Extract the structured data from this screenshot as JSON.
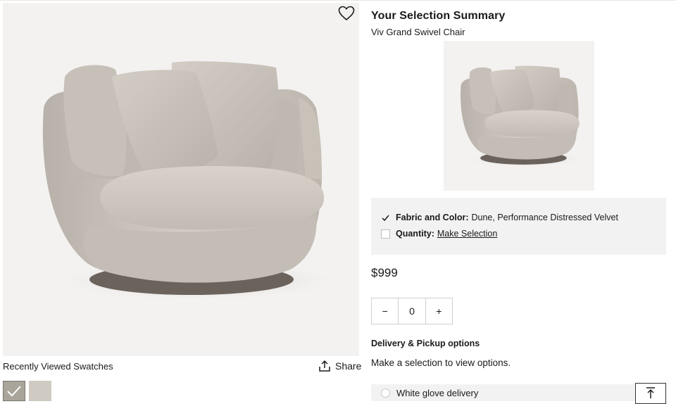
{
  "product": {
    "image_alt": "Viv Grand Swivel Chair",
    "colors": {
      "fabric": "#cbc5bd",
      "fabric_shadow": "#a39c94",
      "base": "#6b625c",
      "background": "#f3f2f1"
    }
  },
  "favorite": {
    "icon": "heart-outline-icon"
  },
  "recently_viewed": {
    "label": "Recently Viewed Swatches",
    "swatches": [
      {
        "color": "#a9a59b",
        "selected": true
      },
      {
        "color": "#cfcbc2",
        "selected": false
      }
    ]
  },
  "share": {
    "label": "Share",
    "icon": "share-upload-icon"
  },
  "summary": {
    "title": "Your Selection Summary",
    "product_name": "Viv Grand Swivel Chair",
    "fabric_label": "Fabric and Color:",
    "fabric_value": "Dune, Performance Distressed Velvet",
    "quantity_label": "Quantity:",
    "quantity_link": "Make Selection"
  },
  "price": "$999",
  "stepper": {
    "minus": "−",
    "value": "0",
    "plus": "+"
  },
  "delivery": {
    "heading": "Delivery & Pickup options",
    "note": "Make a selection to view options.",
    "option_label": "White glove delivery"
  },
  "back_to_top": {
    "icon": "arrow-up-to-top-icon"
  }
}
